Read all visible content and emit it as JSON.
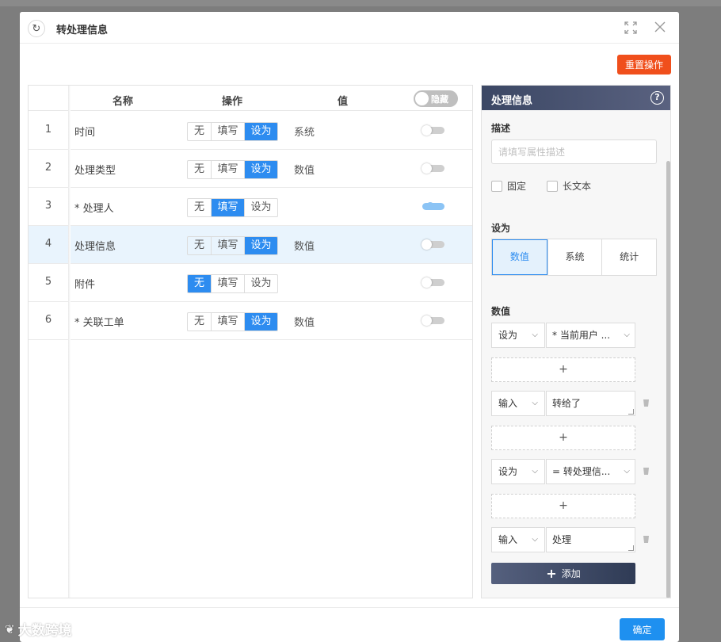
{
  "modal": {
    "title": "转处理信息",
    "reset_label": "重置操作",
    "ok_label": "确定"
  },
  "table": {
    "headers": {
      "name": "名称",
      "operation": "操作",
      "value": "值"
    },
    "hide_toggle_label": "隐藏",
    "rows": [
      {
        "num": "1",
        "name": "时间",
        "ops": [
          "无",
          "填写",
          "设为"
        ],
        "active": "设为",
        "value": "系统",
        "toggle_on": false
      },
      {
        "num": "2",
        "name": "处理类型",
        "ops": [
          "无",
          "填写",
          "设为"
        ],
        "active": "设为",
        "value": "数值",
        "toggle_on": false
      },
      {
        "num": "3",
        "name": "* 处理人",
        "ops": [
          "无",
          "填写",
          "设为"
        ],
        "active": "填写",
        "value": "",
        "toggle_on": true
      },
      {
        "num": "4",
        "name": "处理信息",
        "ops": [
          "无",
          "填写",
          "设为"
        ],
        "active": "设为",
        "value": "数值",
        "toggle_on": false
      },
      {
        "num": "5",
        "name": "附件",
        "ops": [
          "无",
          "填写",
          "设为"
        ],
        "active": "无",
        "value": "",
        "toggle_on": false
      },
      {
        "num": "6",
        "name": "* 关联工单",
        "ops": [
          "无",
          "填写",
          "设为"
        ],
        "active": "设为",
        "value": "数值",
        "toggle_on": false
      }
    ]
  },
  "panel": {
    "title": "处理信息",
    "help_icon": "?",
    "desc_label": "描述",
    "desc_placeholder": "请填写属性描述",
    "fixed_label": "固定",
    "longtext_label": "长文本",
    "setas_label": "设为",
    "setas_options": [
      "数值",
      "系统",
      "统计"
    ],
    "setas_active": "数值",
    "values_label": "数值",
    "plus": "+",
    "value_rows": [
      {
        "mode": "设为",
        "value": "* 当前用户 ..."
      },
      {
        "mode": "输入",
        "value": "转给了"
      },
      {
        "mode": "设为",
        "value": "= 转处理信..."
      },
      {
        "mode": "输入",
        "value": "处理"
      }
    ],
    "add_label": "添加"
  },
  "watermark": {
    "text": "大数跨境"
  },
  "colors": {
    "primary": "#2d8cf0",
    "danger": "#f04f1c",
    "panel_head": "#3b4764"
  }
}
